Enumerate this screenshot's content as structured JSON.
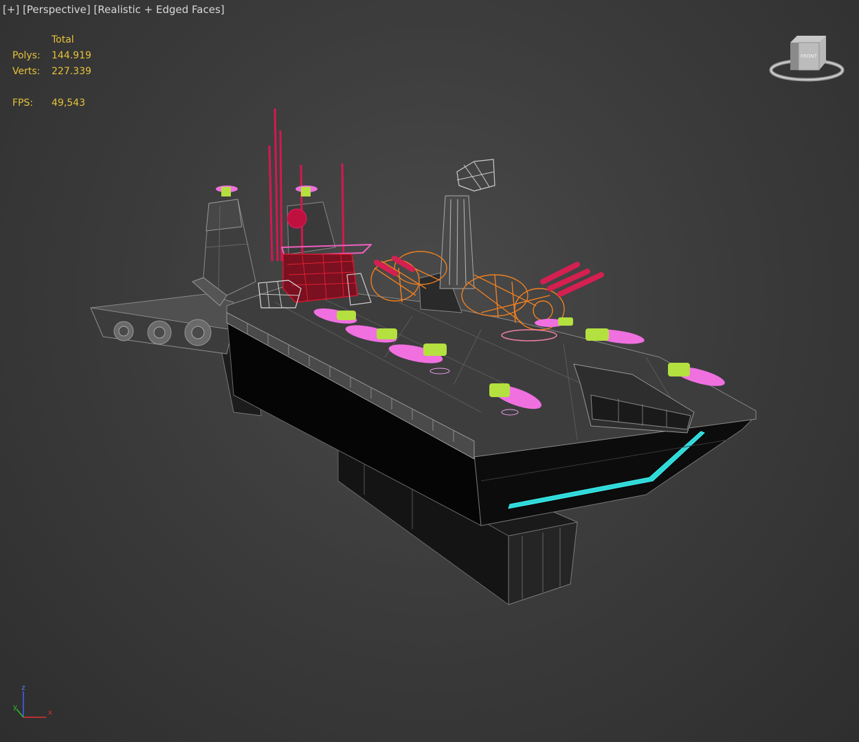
{
  "viewport": {
    "menu_label": "[+]",
    "view_label": "[Perspective]",
    "shading_label": "[Realistic + Edged Faces]"
  },
  "stats": {
    "header": "Total",
    "polys_label": "Polys:",
    "polys_value": "144.919",
    "verts_label": "Verts:",
    "verts_value": "227.339",
    "fps_label": "FPS:",
    "fps_value": "49,543"
  },
  "viewcube": {
    "face_label": "FRONT"
  },
  "axis": {
    "x": "x",
    "y": "y",
    "z": "z"
  },
  "colors": {
    "stats_text": "#e6c23a",
    "hull": "#0a0a0a",
    "deck": "#3a3a3a",
    "wire_red": "#d41850",
    "wire_orange": "#f08020",
    "wire_pink": "#f070e0",
    "wire_lime": "#b4e040",
    "cyan_trim": "#30e0e0"
  },
  "icons": {
    "viewcube": "viewcube-icon",
    "axis": "axis-tripod-icon"
  }
}
